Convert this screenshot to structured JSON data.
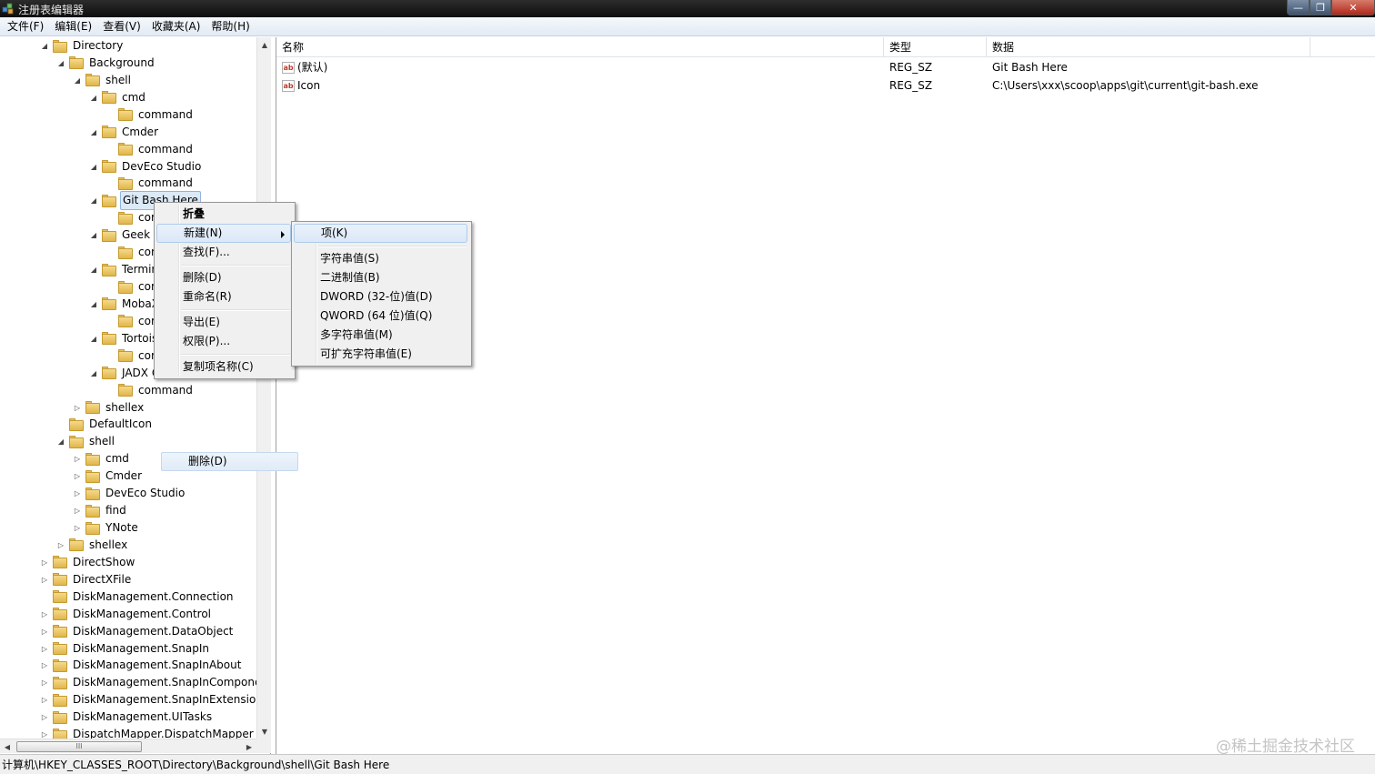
{
  "window": {
    "title": "注册表编辑器",
    "min_label": "—",
    "max_label": "❐",
    "close_label": "✕"
  },
  "menubar": [
    "文件(F)",
    "编辑(E)",
    "查看(V)",
    "收藏夹(A)",
    "帮助(H)"
  ],
  "tree": [
    {
      "label": "Directory",
      "level": 0,
      "expander": "open"
    },
    {
      "label": "Background",
      "level": 1,
      "expander": "open"
    },
    {
      "label": "shell",
      "level": 2,
      "expander": "open"
    },
    {
      "label": "cmd",
      "level": 3,
      "expander": "open"
    },
    {
      "label": "command",
      "level": 4,
      "expander": "none"
    },
    {
      "label": "Cmder",
      "level": 3,
      "expander": "open"
    },
    {
      "label": "command",
      "level": 4,
      "expander": "none"
    },
    {
      "label": "DevEco Studio",
      "level": 3,
      "expander": "open"
    },
    {
      "label": "command",
      "level": 4,
      "expander": "none"
    },
    {
      "label": "Git Bash Here",
      "level": 3,
      "expander": "open",
      "selected": true
    },
    {
      "label": "command",
      "level": 4,
      "expander": "none"
    },
    {
      "label": "Geek Uninstaller",
      "level": 3,
      "expander": "open"
    },
    {
      "label": "command",
      "level": 4,
      "expander": "none"
    },
    {
      "label": "Terminal",
      "level": 3,
      "expander": "open"
    },
    {
      "label": "command",
      "level": 4,
      "expander": "none"
    },
    {
      "label": "MobaXterm",
      "level": 3,
      "expander": "open"
    },
    {
      "label": "command",
      "level": 4,
      "expander": "none"
    },
    {
      "label": "TortoiseGit",
      "level": 3,
      "expander": "open"
    },
    {
      "label": "command",
      "level": 4,
      "expander": "none"
    },
    {
      "label": "JADX GUI",
      "level": 3,
      "expander": "open"
    },
    {
      "label": "command",
      "level": 4,
      "expander": "none"
    },
    {
      "label": "shellex",
      "level": 2,
      "expander": "closed"
    },
    {
      "label": "DefaultIcon",
      "level": 1,
      "expander": "none"
    },
    {
      "label": "shell",
      "level": 1,
      "expander": "open"
    },
    {
      "label": "cmd",
      "level": 2,
      "expander": "closed"
    },
    {
      "label": "Cmder",
      "level": 2,
      "expander": "closed"
    },
    {
      "label": "DevEco Studio",
      "level": 2,
      "expander": "closed"
    },
    {
      "label": "find",
      "level": 2,
      "expander": "closed"
    },
    {
      "label": "YNote",
      "level": 2,
      "expander": "closed"
    },
    {
      "label": "shellex",
      "level": 1,
      "expander": "closed"
    },
    {
      "label": "DirectShow",
      "level": 0,
      "expander": "closed"
    },
    {
      "label": "DirectXFile",
      "level": 0,
      "expander": "closed"
    },
    {
      "label": "DiskManagement.Connection",
      "level": 0,
      "expander": "none"
    },
    {
      "label": "DiskManagement.Control",
      "level": 0,
      "expander": "closed"
    },
    {
      "label": "DiskManagement.DataObject",
      "level": 0,
      "expander": "closed"
    },
    {
      "label": "DiskManagement.SnapIn",
      "level": 0,
      "expander": "closed"
    },
    {
      "label": "DiskManagement.SnapInAbout",
      "level": 0,
      "expander": "closed"
    },
    {
      "label": "DiskManagement.SnapInComponent",
      "level": 0,
      "expander": "closed"
    },
    {
      "label": "DiskManagement.SnapInExtension",
      "level": 0,
      "expander": "closed"
    },
    {
      "label": "DiskManagement.UITasks",
      "level": 0,
      "expander": "closed"
    },
    {
      "label": "DispatchMapper.DispatchMapper",
      "level": 0,
      "expander": "closed"
    }
  ],
  "list": {
    "headers": [
      "名称",
      "类型",
      "数据"
    ],
    "rows": [
      {
        "icon": "ab",
        "name": "(默认)",
        "type": "REG_SZ",
        "data": "Git Bash Here"
      },
      {
        "icon": "ab",
        "name": "Icon",
        "type": "REG_SZ",
        "data": "C:\\Users\\xxx\\scoop\\apps\\git\\current\\git-bash.exe"
      }
    ]
  },
  "context_menu": {
    "items": [
      {
        "label": "折叠",
        "bold": true
      },
      {
        "label": "新建(N)",
        "submenu": true,
        "highlight": true
      },
      {
        "label": "查找(F)..."
      },
      {
        "sep": true
      },
      {
        "label": "删除(D)"
      },
      {
        "label": "重命名(R)"
      },
      {
        "sep": true
      },
      {
        "label": "导出(E)"
      },
      {
        "label": "权限(P)..."
      },
      {
        "sep": true
      },
      {
        "label": "复制项名称(C)"
      }
    ]
  },
  "submenu": {
    "items": [
      {
        "label": "项(K)",
        "highlight": true
      },
      {
        "sep": true
      },
      {
        "label": "字符串值(S)"
      },
      {
        "label": "二进制值(B)"
      },
      {
        "label": "DWORD (32-位)值(D)"
      },
      {
        "label": "QWORD (64 位)值(Q)"
      },
      {
        "label": "多字符串值(M)"
      },
      {
        "label": "可扩充字符串值(E)"
      }
    ]
  },
  "ghost_item": "删除(D)",
  "statusbar": "计算机\\HKEY_CLASSES_ROOT\\Directory\\Background\\shell\\Git Bash Here",
  "watermark": "@稀土掘金技术社区",
  "hscroll_thumb": "III"
}
